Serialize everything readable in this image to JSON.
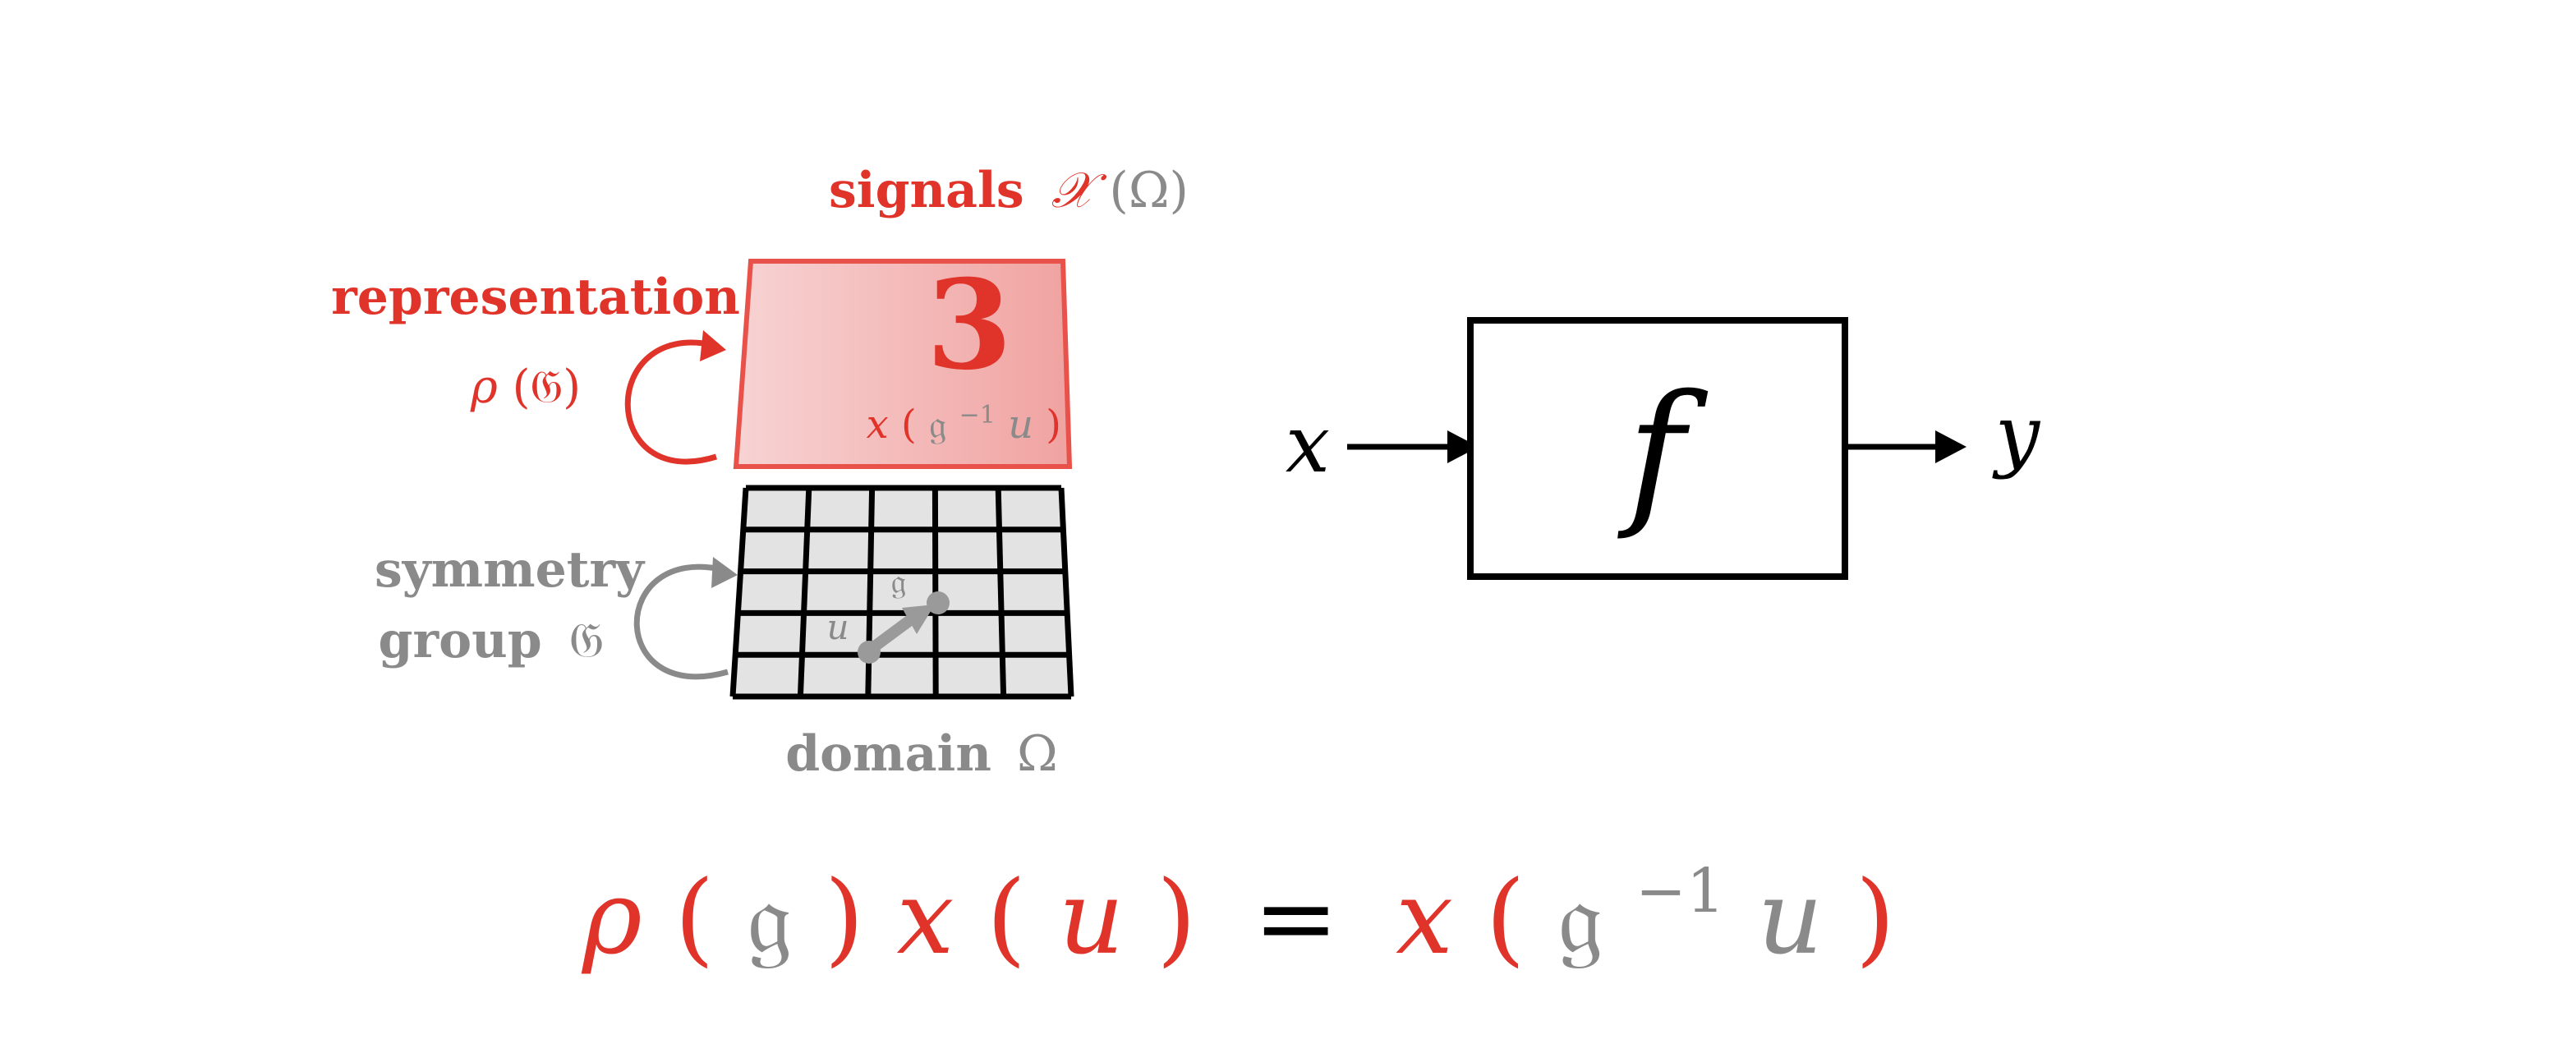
{
  "colors": {
    "red": "#e0342a",
    "gray": "#8a8a8a",
    "black": "#000000",
    "grid_fill": "#e3e3e3",
    "signal_fill_left": "#f6cfcf",
    "signal_fill_right": "#f0a6a4",
    "signal_stroke": "#e8524a"
  },
  "signals": {
    "word": "signals",
    "space_symbol": "𝒳",
    "domain_symbol": "(Ω)"
  },
  "representation": {
    "title": "representation",
    "rho": "ρ",
    "group_arg": "(𝔊)"
  },
  "signal_image": {
    "digit": "3",
    "x": "x",
    "open": "(",
    "g": "𝔤",
    "inv": "−1",
    "u": "u",
    "close": ")"
  },
  "symmetry": {
    "line1": "symmetry",
    "line2": "group",
    "group_symbol": "𝔊",
    "point_u": "u",
    "point_g": "𝔤"
  },
  "domain": {
    "word": "domain",
    "symbol": "Ω"
  },
  "function_block": {
    "input": "x",
    "label": "f",
    "output": "y"
  },
  "equation": {
    "rho": "ρ",
    "lp1": "(",
    "g1": "𝔤",
    "rp1": ")",
    "x1": "x",
    "lp2": "(",
    "u1": "u",
    "rp2": ")",
    "eq": "=",
    "x2": "x",
    "lp3": "(",
    "g2": "𝔤",
    "inv": "−1",
    "u2": "u",
    "rp3": ")"
  }
}
